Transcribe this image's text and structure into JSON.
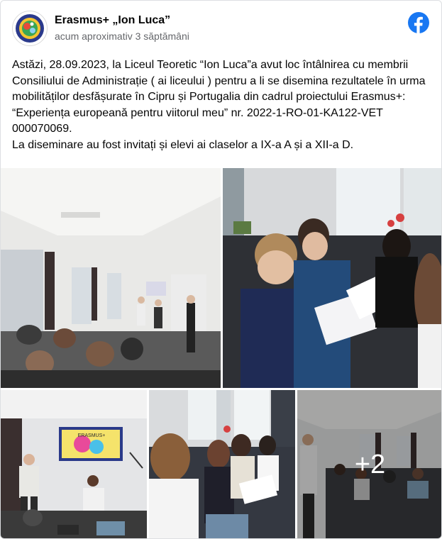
{
  "post": {
    "page_name": "Erasmus+ „Ion Luca”",
    "timestamp": "acum aproximativ 3 săptămâni",
    "body_line_1": "Astăzi, 28.09.2023, la Liceul Teoretic “Ion Luca”a avut loc întâlnirea cu membrii Consiliului de Administrație ( ai liceului ) pentru a li se disemina rezultatele în urma mobilităților desfășurate în Cipru și Portugalia din cadrul proiectului Erasmus+: “Experiența europeană pentru viitorul meu” nr. 2022-1-RO-01-KA122-VET 000070069.",
    "body_line_2": "La diseminare au fost invitați și elevi ai claselor a IX-a A și a XII-a D.",
    "facebook_icon": "facebook-icon"
  },
  "gallery": {
    "photos": [
      {
        "name": "photo-classroom-wide"
      },
      {
        "name": "photo-students-reading"
      },
      {
        "name": "photo-presentation-screen"
      },
      {
        "name": "photo-students-seated"
      },
      {
        "name": "photo-classroom-rear"
      }
    ],
    "more_count": "+2",
    "screen_text": "ERASMUS+"
  },
  "colors": {
    "facebook_blue": "#1877f2",
    "secondary_text": "#65676b",
    "primary_text": "#050505"
  }
}
